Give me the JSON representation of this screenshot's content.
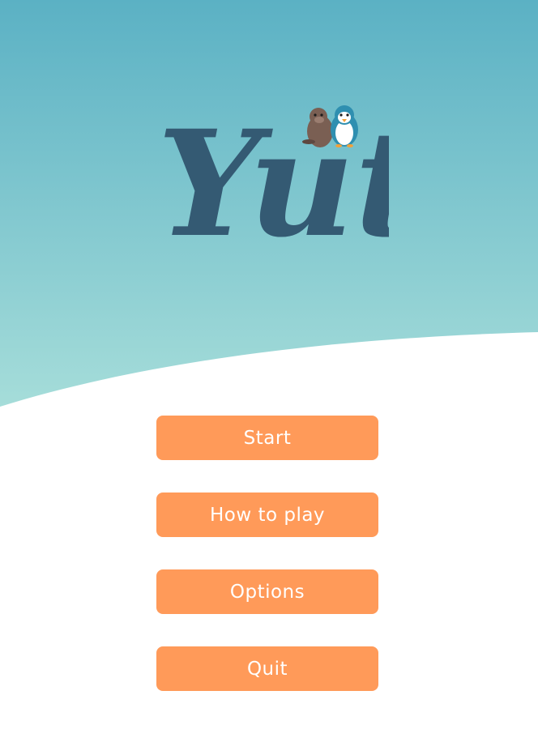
{
  "title": {
    "logo_text": "Yut",
    "mascots": [
      "seal-icon",
      "penguin-icon"
    ]
  },
  "menu": {
    "start_label": "Start",
    "how_to_play_label": "How to play",
    "options_label": "Options",
    "quit_label": "Quit"
  },
  "colors": {
    "sky_top": "#5bb1c4",
    "sky_bottom": "#aee2dc",
    "ground": "#ffffff",
    "logo": "#345a73",
    "button": "#ff9a59",
    "button_text": "#ffffff"
  }
}
